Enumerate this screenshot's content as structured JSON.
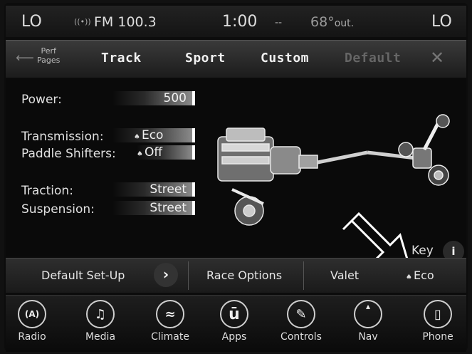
{
  "status": {
    "left_temp": "LO",
    "radio": "FM 100.3",
    "time": "1:00",
    "dash": "--",
    "outside_temp": "68°",
    "outside_unit": "out.",
    "right_temp": "LO"
  },
  "tabs": {
    "perf_pages_line1": "Perf",
    "perf_pages_line2": "Pages",
    "track": "Track",
    "sport": "Sport",
    "custom": "Custom",
    "default": "Default",
    "close": "✕"
  },
  "settings": {
    "power_label": "Power:",
    "power_value": "500",
    "transmission_label": "Transmission:",
    "transmission_value": "Eco",
    "paddle_label": "Paddle Shifters:",
    "paddle_value": "Off",
    "traction_label": "Traction:",
    "traction_value": "Street",
    "suspension_label": "Suspension:",
    "suspension_value": "Street"
  },
  "key": {
    "label": "Key",
    "info": "i"
  },
  "options": {
    "default_setup": "Default Set-Up",
    "race_options": "Race Options",
    "valet": "Valet",
    "eco": "Eco"
  },
  "dock": [
    {
      "label": "Radio",
      "glyph": "(A)"
    },
    {
      "label": "Media",
      "glyph": "♫"
    },
    {
      "label": "Climate",
      "glyph": "≈"
    },
    {
      "label": "Apps",
      "glyph": "ū"
    },
    {
      "label": "Controls",
      "glyph": "✎"
    },
    {
      "label": "Nav",
      "glyph": "▴"
    },
    {
      "label": "Phone",
      "glyph": "▯"
    }
  ]
}
